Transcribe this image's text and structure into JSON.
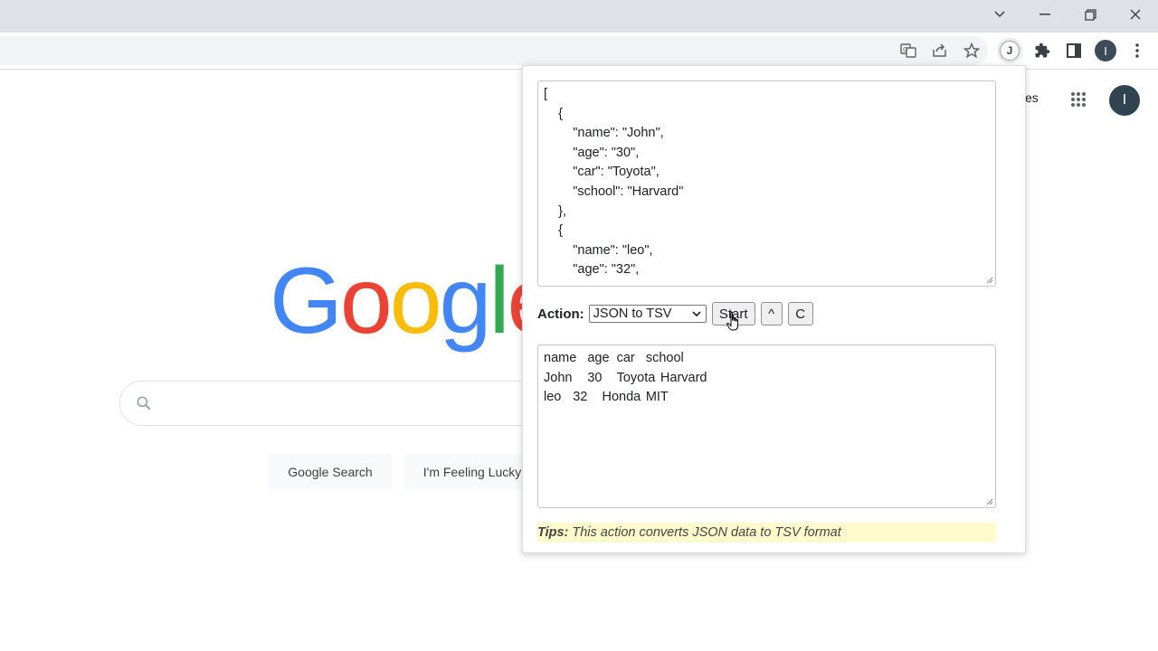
{
  "browser": {
    "icons": [
      "chevron-down-icon",
      "minimize-icon",
      "restore-icon",
      "close-icon",
      "translate-icon",
      "share-icon",
      "star-icon",
      "extension-j-icon",
      "puzzle-icon",
      "side-panel-icon",
      "profile-icon",
      "more-icon"
    ],
    "extension_badge": "J",
    "profile_letter": "I"
  },
  "google": {
    "images_link_partial": "es",
    "avatar_letter": "I",
    "search_button": "Google Search",
    "lucky_button": "I'm Feeling Lucky"
  },
  "popup": {
    "input_lines": [
      "[",
      "    {",
      "        \"name\": \"John\",",
      "        \"age\": \"30\",",
      "        \"car\": \"Toyota\",",
      "        \"school\": \"Harvard\"",
      "    },",
      "    {",
      "        \"name\": \"leo\",",
      "        \"age\": \"32\","
    ],
    "action_label": "Action:",
    "action_selected": "JSON to TSV",
    "start_button": "Start",
    "up_button": "^",
    "clear_button": "C",
    "output_lines": [
      "name\tage\tcar\tschool",
      "John\t30\tToyota\tHarvard",
      "leo\t32\tHonda\tMIT"
    ],
    "tips_label": "Tips:",
    "tips_text": "This action converts JSON data to TSV format"
  }
}
